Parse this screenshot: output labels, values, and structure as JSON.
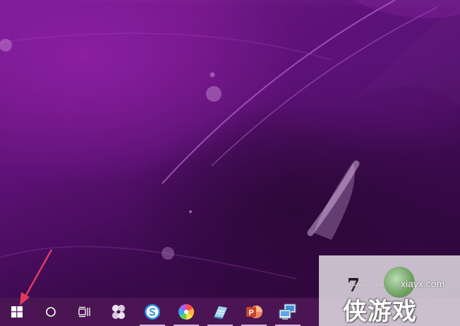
{
  "taskbar": {
    "items": [
      {
        "name": "start-button",
        "icon": "windows-logo-icon",
        "running": false
      },
      {
        "name": "search-button",
        "icon": "circle-search-icon",
        "running": false
      },
      {
        "name": "task-view-button",
        "icon": "task-view-icon",
        "running": false
      },
      {
        "name": "app-pinwheel",
        "icon": "pinwheel-app-icon",
        "running": false
      },
      {
        "name": "app-sogou-browser",
        "icon": "blue-s-browser-icon",
        "running": true
      },
      {
        "name": "app-colorful-pinwheel",
        "icon": "rainbow-pinwheel-icon",
        "running": true
      },
      {
        "name": "app-notes",
        "icon": "blue-notes-icon",
        "running": true
      },
      {
        "name": "app-powerpoint",
        "icon": "powerpoint-icon",
        "running": true
      },
      {
        "name": "app-network",
        "icon": "network-computer-icon",
        "running": true
      }
    ],
    "background": "#4a1552"
  },
  "watermark": {
    "site": "xiayx.com",
    "big_text": "侠游戏",
    "small_text": "XIAYOUXI.COM",
    "digit": "7"
  },
  "colors": {
    "accent_arrow": "#e23a5e",
    "desktop_primary": "#7d1a93"
  }
}
